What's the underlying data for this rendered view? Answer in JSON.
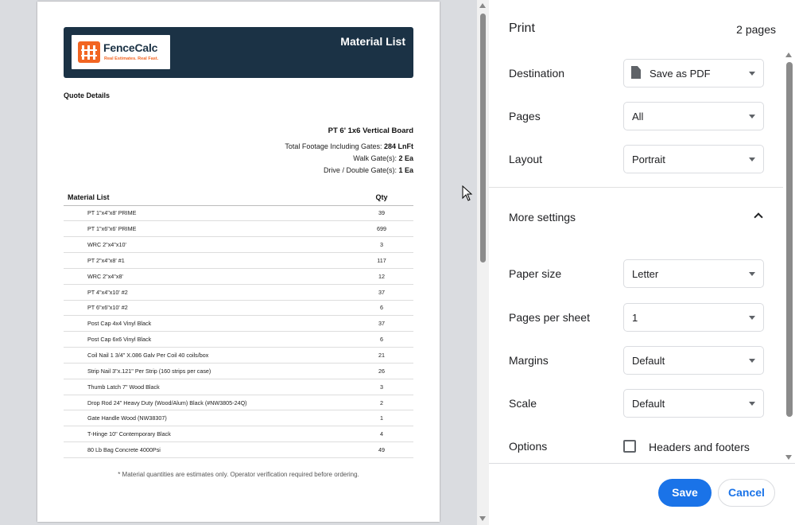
{
  "preview": {
    "header": {
      "logo_name": "FenceCalc",
      "logo_tagline": "Real Estimates. Real Fast.",
      "title": "Material List"
    },
    "quote_title": "Quote Details",
    "product": "PT 6' 1x6 Vertical Board",
    "summary": [
      {
        "label": "Total Footage Including Gates:",
        "value": "284 LnFt"
      },
      {
        "label": "Walk Gate(s):",
        "value": "2 Ea"
      },
      {
        "label": "Drive / Double Gate(s):",
        "value": "1 Ea"
      }
    ],
    "table": {
      "headers": {
        "item": "Material List",
        "qty": "Qty"
      },
      "rows": [
        {
          "item": "PT 1\"x4\"x8' PRIME",
          "qty": "39"
        },
        {
          "item": "PT 1\"x6\"x6' PRIME",
          "qty": "699"
        },
        {
          "item": "WRC 2\"x4\"x10'",
          "qty": "3"
        },
        {
          "item": "PT 2\"x4\"x8' #1",
          "qty": "117"
        },
        {
          "item": "WRC 2\"x4\"x8'",
          "qty": "12"
        },
        {
          "item": "PT 4\"x4\"x10' #2",
          "qty": "37"
        },
        {
          "item": "PT 6\"x6\"x10' #2",
          "qty": "6"
        },
        {
          "item": "Post Cap 4x4 Vinyl Black",
          "qty": "37"
        },
        {
          "item": "Post Cap 6x6 Vinyl Black",
          "qty": "6"
        },
        {
          "item": "Coil Nail 1 3/4\" X.086 Galv Per Coil 40 coils/box",
          "qty": "21"
        },
        {
          "item": "Strip Nail 3\"x.121\" Per Strip (160 strips per case)",
          "qty": "26"
        },
        {
          "item": "Thumb Latch 7\" Wood Black",
          "qty": "3"
        },
        {
          "item": "Drop Rod 24\" Heavy Duty (Wood/Alum) Black (#NW3805-24Q)",
          "qty": "2"
        },
        {
          "item": "Gate Handle Wood (NW38307)",
          "qty": "1"
        },
        {
          "item": "T-Hinge 10\" Contemporary Black",
          "qty": "4"
        },
        {
          "item": "80 Lb Bag Concrete 4000Psi",
          "qty": "49"
        }
      ]
    },
    "footnote": "* Material quantities are estimates only. Operator verification required before ordering."
  },
  "print": {
    "title": "Print",
    "page_count": "2 pages",
    "destination": {
      "label": "Destination",
      "value": "Save as PDF"
    },
    "pages": {
      "label": "Pages",
      "value": "All"
    },
    "layout": {
      "label": "Layout",
      "value": "Portrait"
    },
    "more_settings": "More settings",
    "paper_size": {
      "label": "Paper size",
      "value": "Letter"
    },
    "pages_per_sheet": {
      "label": "Pages per sheet",
      "value": "1"
    },
    "margins": {
      "label": "Margins",
      "value": "Default"
    },
    "scale": {
      "label": "Scale",
      "value": "Default"
    },
    "options": {
      "label": "Options",
      "checkbox_label": "Headers and footers",
      "checked": false
    },
    "save_label": "Save",
    "cancel_label": "Cancel"
  },
  "colors": {
    "header_bg": "#1b3245",
    "brand_orange": "#f26522",
    "accent_blue": "#1a73e8"
  }
}
